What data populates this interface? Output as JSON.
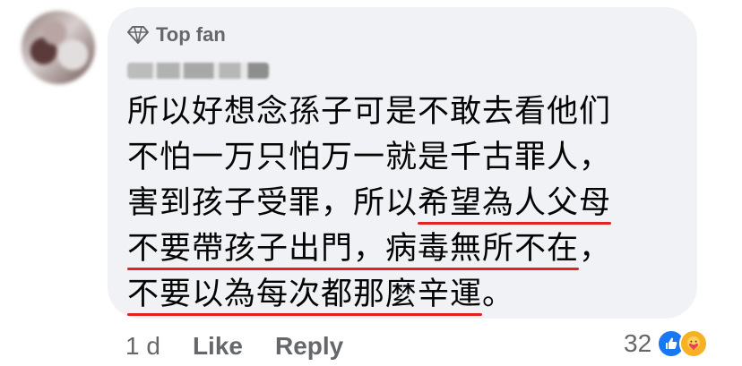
{
  "comment": {
    "badge": "Top fan",
    "lines": [
      {
        "segments": [
          {
            "text": "所以好想念孫子可是不敢去看他们",
            "underline": false
          }
        ]
      },
      {
        "segments": [
          {
            "text": "不怕一万只怕万一就是千古罪人，",
            "underline": false
          }
        ]
      },
      {
        "segments": [
          {
            "text": "害到孩子受罪，所以",
            "underline": false
          },
          {
            "text": "希望為人父母",
            "underline": true
          }
        ]
      },
      {
        "segments": [
          {
            "text": "不要帶孩子出門，病毒無所不在",
            "underline": true
          },
          {
            "text": "，",
            "underline": false
          }
        ]
      },
      {
        "segments": [
          {
            "text": "不要以為每次都那麼辛運",
            "underline": true
          },
          {
            "text": "。",
            "underline": false
          }
        ]
      }
    ]
  },
  "actions": {
    "time": "1 d",
    "like": "Like",
    "reply": "Reply"
  },
  "reactions": {
    "count": "32",
    "icons": [
      "like-icon",
      "care-icon"
    ]
  },
  "colors": {
    "bubble": "#f0f2f5",
    "muted_text": "#65676b",
    "underline": "#e2221f",
    "like_blue": "#1877f2",
    "care_yellow": "#f7b125"
  }
}
